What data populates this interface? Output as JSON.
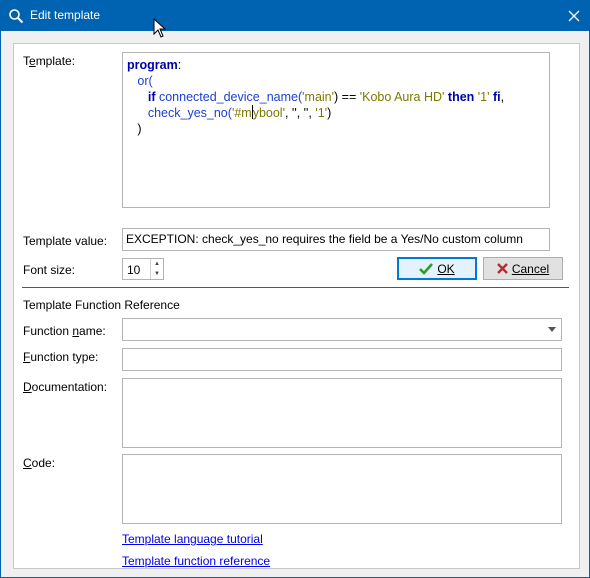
{
  "window": {
    "title": "Edit template"
  },
  "labels": {
    "template": "Template:",
    "template_value": "Template value:",
    "font_size": "Font size:",
    "reference_section": "Template Function Reference",
    "function_name": "Function name:",
    "function_type": "Function type:",
    "documentation": "Documentation:",
    "code": "Code:"
  },
  "editor": {
    "line1_kw": "program",
    "line1_colon": ":",
    "line2": "or(",
    "line3_if": "if",
    "line3_fn": "connected_device_name",
    "line3_open": "(",
    "line3_arg": "'main'",
    "line3_mid": ") == ",
    "line3_str": "'Kobo Aura HD'",
    "line3_then": "then",
    "line3_val": "'1'",
    "line3_fi": "fi",
    "line3_comma": ",",
    "line4_fn": "check_yes_no",
    "line4_open": "(",
    "line4_arg_a": "'#m",
    "line4_arg_b": "ybool'",
    "line4_rest": ", '', '', ",
    "line4_val": "'1'",
    "line4_close": ")",
    "line5": ")"
  },
  "template_value": "EXCEPTION:  check_yes_no requires the field be a Yes/No custom column",
  "font_size_value": "10",
  "buttons": {
    "ok": "OK",
    "cancel": "Cancel"
  },
  "inputs": {
    "function_name": "",
    "function_type": "",
    "documentation": "",
    "code": ""
  },
  "links": {
    "tutorial": "Template language tutorial",
    "reference": "Template function reference"
  },
  "colors": {
    "titlebar": "#0063b1",
    "keyword": "#0000b0",
    "function": "#1d3fd6",
    "string": "#7a7a00",
    "ok_check": "#2e9e2e",
    "cancel_x": "#c0262d"
  }
}
